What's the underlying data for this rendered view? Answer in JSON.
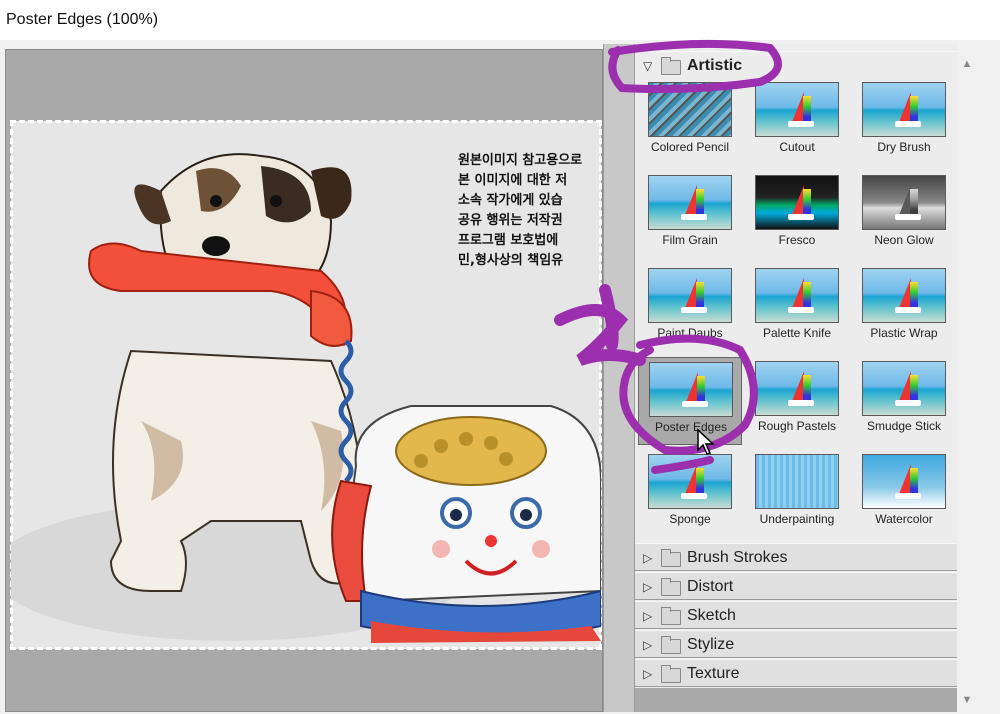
{
  "window": {
    "title": "Poster Edges (100%)"
  },
  "preview": {
    "image_text_lines": [
      "원본이미지 참고용으로",
      "본 이미지에 대한 저",
      "소속 작가에게 있습",
      "공유 행위는 저작권",
      "프로그램 보호법에",
      "민,형사상의 책임유"
    ]
  },
  "gallery": {
    "artistic": {
      "label": "Artistic",
      "filters": [
        {
          "label": "Colored Pencil",
          "icon": "colored-pencil-thumbnail"
        },
        {
          "label": "Cutout",
          "icon": "cutout-thumbnail"
        },
        {
          "label": "Dry Brush",
          "icon": "dry-brush-thumbnail"
        },
        {
          "label": "Film Grain",
          "icon": "film-grain-thumbnail"
        },
        {
          "label": "Fresco",
          "icon": "fresco-thumbnail"
        },
        {
          "label": "Neon Glow",
          "icon": "neon-glow-thumbnail"
        },
        {
          "label": "Paint Daubs",
          "icon": "paint-daubs-thumbnail"
        },
        {
          "label": "Palette Knife",
          "icon": "palette-knife-thumbnail"
        },
        {
          "label": "Plastic Wrap",
          "icon": "plastic-wrap-thumbnail"
        },
        {
          "label": "Poster Edges",
          "icon": "poster-edges-thumbnail",
          "selected": true
        },
        {
          "label": "Rough Pastels",
          "icon": "rough-pastels-thumbnail"
        },
        {
          "label": "Smudge Stick",
          "icon": "smudge-stick-thumbnail"
        },
        {
          "label": "Sponge",
          "icon": "sponge-thumbnail"
        },
        {
          "label": "Underpainting",
          "icon": "underpainting-thumbnail"
        },
        {
          "label": "Watercolor",
          "icon": "watercolor-thumbnail"
        }
      ]
    },
    "categories": [
      {
        "label": "Brush Strokes"
      },
      {
        "label": "Distort"
      },
      {
        "label": "Sketch"
      },
      {
        "label": "Stylize"
      },
      {
        "label": "Texture"
      }
    ]
  },
  "colors": {
    "annotation": "#9b2fae",
    "panel_bg": "#a9a9a9",
    "selected_thumb": "#a9a9a9"
  }
}
